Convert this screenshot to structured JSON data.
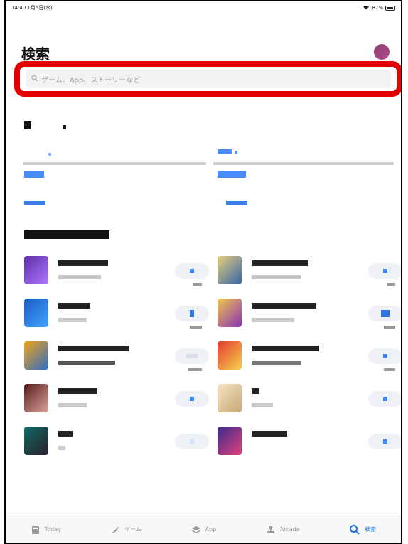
{
  "status": {
    "time": "14:40",
    "date": "1月5日(水)",
    "battery": "87%"
  },
  "page": {
    "title": "検索"
  },
  "search": {
    "placeholder": "ゲーム、App、ストーリーなど"
  },
  "tabs": [
    {
      "label": "Today",
      "icon": "today-icon"
    },
    {
      "label": "ゲーム",
      "icon": "rocket-icon"
    },
    {
      "label": "App",
      "icon": "stack-icon"
    },
    {
      "label": "Arcade",
      "icon": "joystick-icon"
    },
    {
      "label": "検索",
      "icon": "search-icon"
    }
  ]
}
